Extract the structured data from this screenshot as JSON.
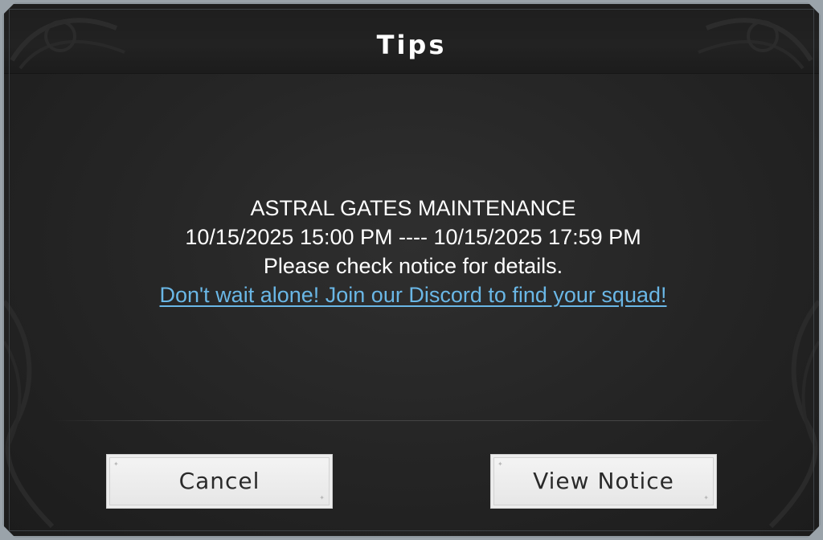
{
  "dialog": {
    "title": "Tips",
    "message": {
      "line1": "ASTRAL GATES MAINTENANCE",
      "line2": "10/15/2025 15:00 PM ---- 10/15/2025 17:59 PM",
      "line3": "Please check notice for details.",
      "link": "Don't wait alone! Join our Discord to find your squad!"
    },
    "buttons": {
      "cancel": "Cancel",
      "view_notice": "View Notice"
    }
  },
  "colors": {
    "background": "#262626",
    "text": "#ffffff",
    "link": "#6ab7e6",
    "button_bg": "#eeeeee",
    "button_text": "#2a2a2a",
    "frame": "#8e979e"
  }
}
